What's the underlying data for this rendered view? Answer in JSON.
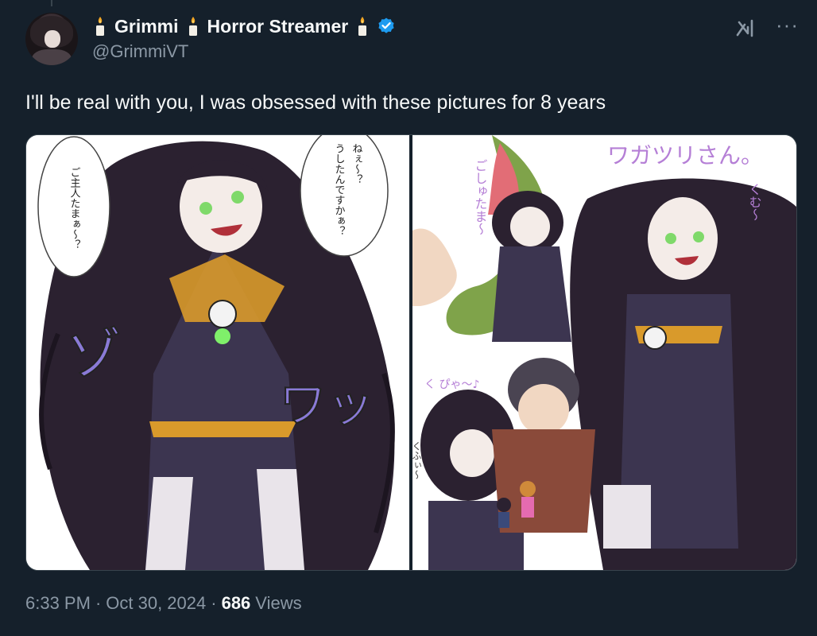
{
  "author": {
    "display_name_parts": [
      "Grimmi",
      "Horror Streamer"
    ],
    "handle": "@GrimmiVT",
    "verified": true,
    "avatar_icon": "avatar-image",
    "name_decoration_icon": "candle-icon"
  },
  "header_actions": {
    "grok_icon": "grok-icon",
    "more_icon": "more-icon",
    "more_label": "···"
  },
  "tweet": {
    "text": "I'll be real with you, I was obsessed with these pictures for 8 years"
  },
  "media": {
    "left_image": {
      "speech_bubble_1": "ご主人たまぁ〜？",
      "speech_bubble_2_line1": "ねぇ〜？",
      "speech_bubble_2_line2": "うしたんですかぁ？",
      "sfx_1": "ゾ",
      "sfx_2": "ワッ"
    },
    "right_image": {
      "caption_top": "ワガツリさん。",
      "caption_kuhya": "くふぃ〜",
      "caption_gosyujin": "ごしゅたま〜",
      "caption_kyu": "く ぴゃ〜♪",
      "caption_mumu": "くむ〜"
    }
  },
  "footer": {
    "time": "6:33 PM",
    "separator": "·",
    "date": "Oct 30, 2024",
    "views_count": "686",
    "views_label": "Views"
  },
  "colors": {
    "background": "#15202b",
    "text_primary": "#f7f9f9",
    "text_secondary": "#8b98a5",
    "verified_blue": "#1d9bf0",
    "border": "#38444d"
  }
}
